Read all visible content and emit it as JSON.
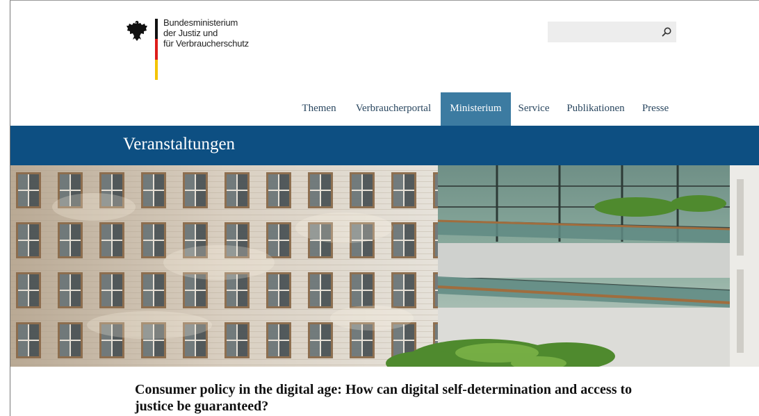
{
  "header": {
    "logo_lines": [
      "Bundesministerium",
      "der Justiz und",
      "für Verbraucherschutz"
    ],
    "flag_colors": [
      "#111111",
      "#dd1c1a",
      "#f4c400"
    ]
  },
  "search": {
    "placeholder": "",
    "icon": "search-icon"
  },
  "nav": {
    "items": [
      {
        "label": "Themen",
        "active": false
      },
      {
        "label": "Verbraucherportal",
        "active": false
      },
      {
        "label": "Ministerium",
        "active": true
      },
      {
        "label": "Service",
        "active": false
      },
      {
        "label": "Publikationen",
        "active": false
      },
      {
        "label": "Presse",
        "active": false
      }
    ]
  },
  "page": {
    "section_title": "Veranstaltungen",
    "headline": "Consumer policy in the digital age: How can digital self-determination and access to justice be guaranteed?"
  },
  "colors": {
    "title_bar": "#0d4f82",
    "nav_active": "#3c7ba1",
    "nav_text": "#29465f"
  }
}
